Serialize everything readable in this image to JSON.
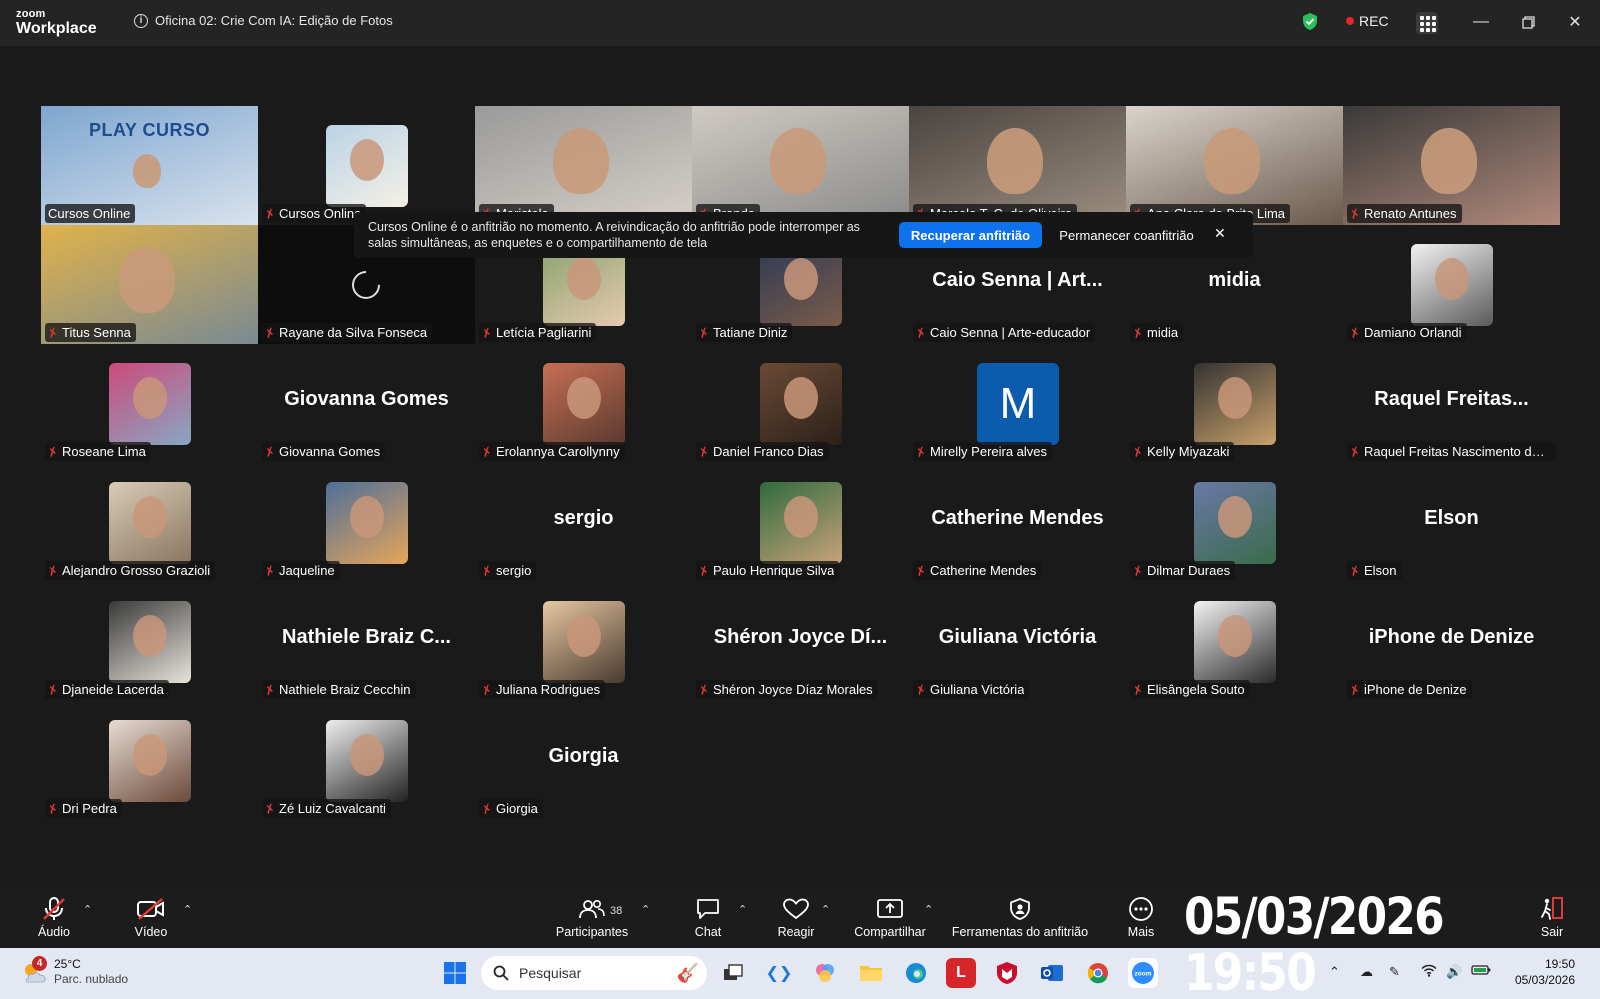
{
  "app": {
    "brand_small": "zoom",
    "brand_big": "Workplace",
    "meeting_title": "Oficina 02: Crie Com IA: Edição de Fotos",
    "rec_label": "REC",
    "window_controls": [
      "minimize-icon",
      "restore-icon",
      "close-icon"
    ]
  },
  "banner": {
    "message": "Cursos Online é o anfitrião no momento. A reivindicação do anfitrião pode interromper as salas simultâneas, as enquetes e o compartilhamento de tela",
    "primary_button": "Recuperar anfitrião",
    "secondary_button": "Permanecer coanfitrião",
    "close_glyph": "✕"
  },
  "participants": [
    {
      "name": "Cursos Online",
      "kind": "video",
      "active": true,
      "muted": false,
      "art": "PLAY CURSO"
    },
    {
      "name": "Cursos Online",
      "kind": "avatar",
      "muted": true
    },
    {
      "name": "Maristela",
      "kind": "video",
      "muted": true
    },
    {
      "name": "Brenda",
      "kind": "video",
      "muted": true
    },
    {
      "name": "Marcelo T. C. de Oliveira",
      "kind": "video",
      "muted": true
    },
    {
      "name": "Ana Clara de Brito Lima",
      "kind": "video",
      "muted": true
    },
    {
      "name": "Renato Antunes",
      "kind": "video",
      "muted": true
    },
    {
      "name": "Titus Senna",
      "kind": "video",
      "muted": true
    },
    {
      "name": "Rayane da Silva Fonseca",
      "kind": "loading",
      "muted": true
    },
    {
      "name": "Letícia Pagliarini",
      "kind": "avatar",
      "muted": true
    },
    {
      "name": "Tatiane Diniz",
      "kind": "avatar",
      "muted": true
    },
    {
      "name": "Caio Senna | Arte-educador",
      "kind": "text",
      "display": "Caio Senna | Art...",
      "muted": true
    },
    {
      "name": "midia",
      "kind": "text",
      "display": "midia",
      "muted": true
    },
    {
      "name": "Damiano Orlandi",
      "kind": "avatar",
      "muted": true
    },
    {
      "name": "Roseane Lima",
      "kind": "avatar",
      "muted": true
    },
    {
      "name": "Giovanna Gomes",
      "kind": "text",
      "display": "Giovanna Gomes",
      "muted": true
    },
    {
      "name": "Erolannya Carollynny",
      "kind": "avatar",
      "muted": true
    },
    {
      "name": "Daniel Franco Dias",
      "kind": "avatar",
      "muted": true
    },
    {
      "name": "Mirelly Pereira alves",
      "kind": "letter",
      "display": "M",
      "muted": true
    },
    {
      "name": "Kelly Miyazaki",
      "kind": "avatar",
      "muted": true
    },
    {
      "name": "Raquel Freitas Nascimento dos ...",
      "kind": "text",
      "display": "Raquel  Freitas...",
      "muted": true
    },
    {
      "name": "Alejandro Grosso Grazioli",
      "kind": "avatar",
      "muted": true
    },
    {
      "name": "Jaqueline",
      "kind": "avatar",
      "muted": true
    },
    {
      "name": "sergio",
      "kind": "text",
      "display": "sergio",
      "muted": true
    },
    {
      "name": "Paulo Henrique Silva",
      "kind": "avatar",
      "muted": true
    },
    {
      "name": "Catherine Mendes",
      "kind": "text",
      "display": "Catherine Mendes",
      "muted": true
    },
    {
      "name": "Dilmar Duraes",
      "kind": "avatar",
      "muted": true
    },
    {
      "name": "Elson",
      "kind": "text",
      "display": "Elson",
      "muted": true
    },
    {
      "name": "Djaneide Lacerda",
      "kind": "avatar",
      "muted": true
    },
    {
      "name": "Nathiele Braiz Cecchin",
      "kind": "text",
      "display": "Nathiele  Braiz  C...",
      "muted": true
    },
    {
      "name": "Juliana Rodrigues",
      "kind": "avatar",
      "muted": true
    },
    {
      "name": "Shéron Joyce Díaz Morales",
      "kind": "text",
      "display": "Shéron  Joyce  Dí...",
      "muted": true
    },
    {
      "name": "Giuliana Victória",
      "kind": "text",
      "display": "Giuliana Victória",
      "muted": true
    },
    {
      "name": "Elisângela Souto",
      "kind": "avatar",
      "muted": true
    },
    {
      "name": "iPhone de Denize",
      "kind": "text",
      "display": "iPhone de Denize",
      "muted": true
    },
    {
      "name": "Dri Pedra",
      "kind": "avatar",
      "muted": true
    },
    {
      "name": "Zé Luiz Cavalcanti",
      "kind": "avatar",
      "muted": true
    },
    {
      "name": "Giorgia",
      "kind": "text",
      "display": "Giorgia",
      "muted": true
    }
  ],
  "toolbar": {
    "audio": "Áudio",
    "video": "Vídeo",
    "participants": "Participantes",
    "participants_count": "38",
    "chat": "Chat",
    "react": "Reagir",
    "share": "Compartilhar",
    "host_tools": "Ferramentas do anfitrião",
    "more": "Mais",
    "leave": "Sair",
    "overlay_clock": "05/03/2026 19:50"
  },
  "taskbar": {
    "weather_badge": "4",
    "temperature": "25°C",
    "condition": "Parc. nublado",
    "search_placeholder": "Pesquisar",
    "time": "19:50",
    "date": "05/03/2026"
  },
  "colors": {
    "accent_blue": "#0e72ed",
    "active_speaker": "#30d158",
    "muted_red": "#e53935",
    "toolbar_bg": "#1c1c1c",
    "gallery_bg": "#1a1a1a"
  }
}
